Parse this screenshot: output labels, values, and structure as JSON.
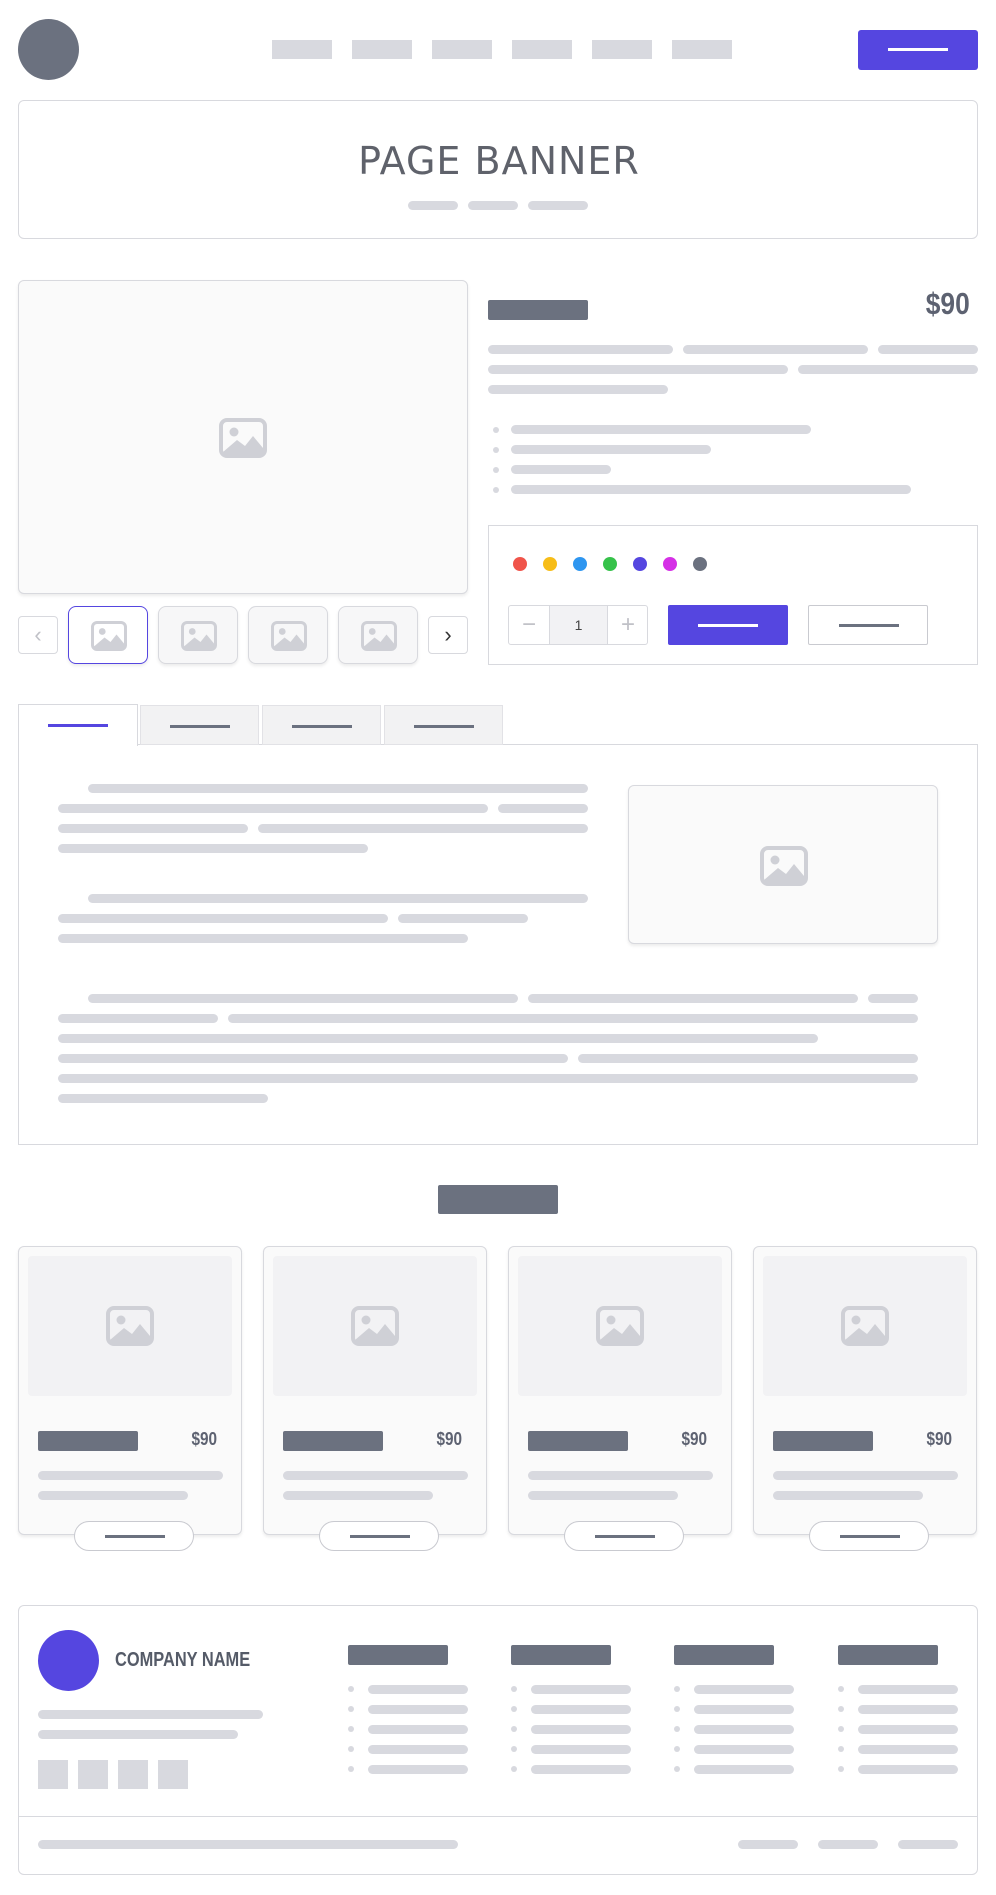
{
  "header": {
    "logo": "avatar-circle",
    "nav_links": [
      "",
      "",
      "",
      "",
      "",
      ""
    ],
    "cta_button_color": "#5546e0"
  },
  "banner": {
    "title": "PAGE BANNER"
  },
  "product": {
    "price": "$90",
    "quantity": "1",
    "quantity_minus": "−",
    "quantity_plus": "+",
    "gallery_prev": "‹",
    "gallery_next": "›",
    "color_swatches": [
      "#f0544a",
      "#f7bd18",
      "#2e96f0",
      "#36c24a",
      "#5546e0",
      "#d530e6",
      "#6b717f"
    ],
    "primary_color": "#5546e0"
  },
  "related": {
    "cards": [
      {
        "price": "$90"
      },
      {
        "price": "$90"
      },
      {
        "price": "$90"
      },
      {
        "price": "$90"
      }
    ]
  },
  "footer": {
    "company_name": "COMPANY NAME",
    "logo_color": "#5546e0"
  },
  "icons": {
    "image_placeholder": "image-icon",
    "chevron_left": "chevron-left-icon",
    "chevron_right": "chevron-right-icon",
    "minus": "minus-icon",
    "plus": "plus-icon"
  }
}
